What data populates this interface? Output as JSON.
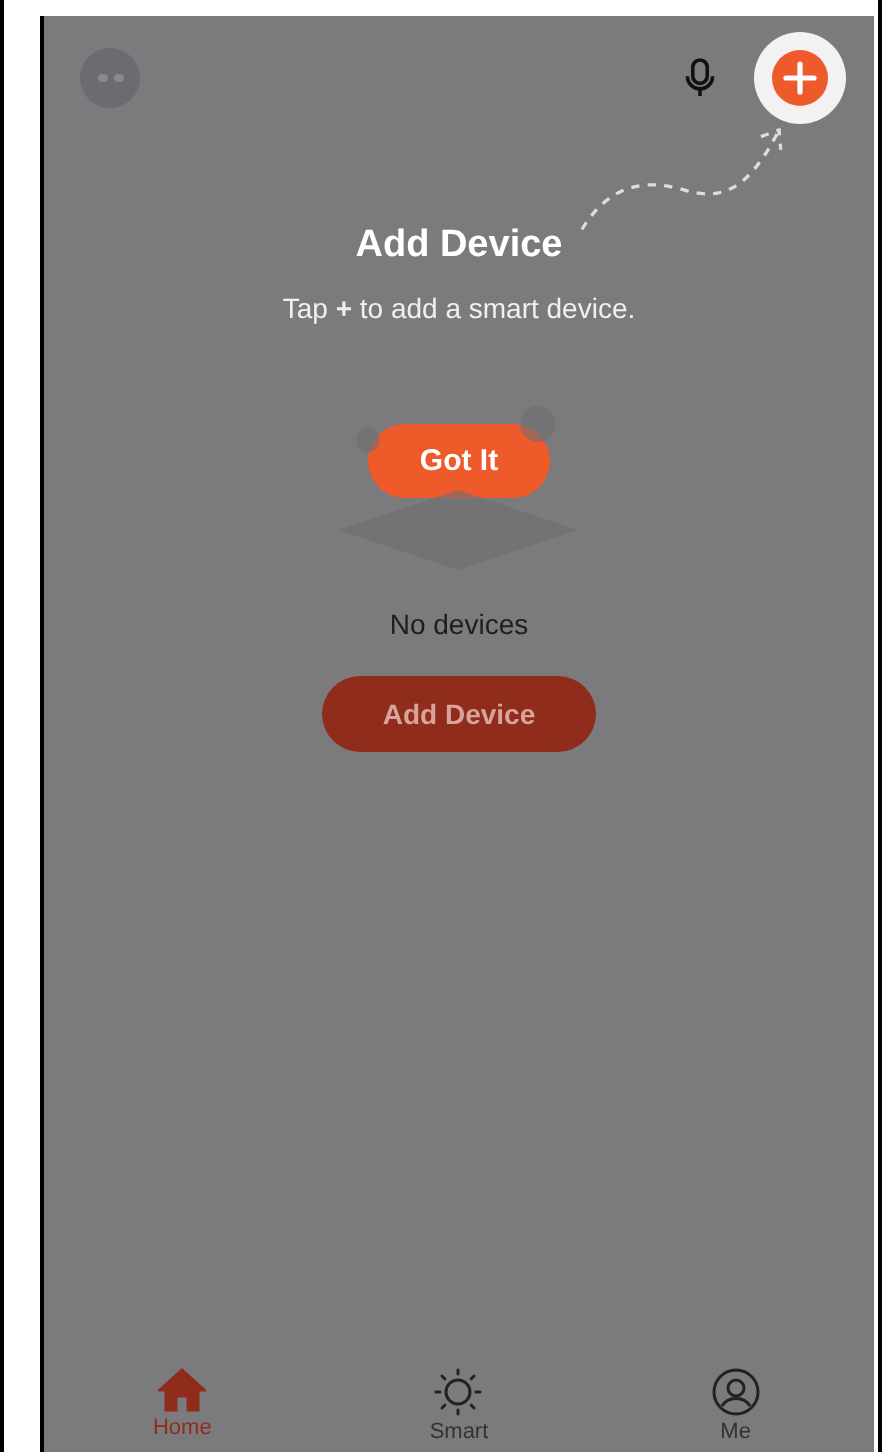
{
  "top_bar": {
    "buttons": [
      {
        "kind": "mic"
      },
      {
        "kind": "add",
        "highlighted": true
      }
    ]
  },
  "coach_mark": {
    "title": "Add Device",
    "hint": "Tap **+** to add a smart device.",
    "button": "Got It"
  },
  "empty_state": {
    "message": "No devices",
    "button": "Add Device"
  },
  "tabs": [
    {
      "kind": "home",
      "label": "Home",
      "selected": true
    },
    {
      "kind": "smart",
      "label": "Smart",
      "selected": false
    },
    {
      "kind": "me",
      "label": "Me",
      "selected": false
    }
  ]
}
